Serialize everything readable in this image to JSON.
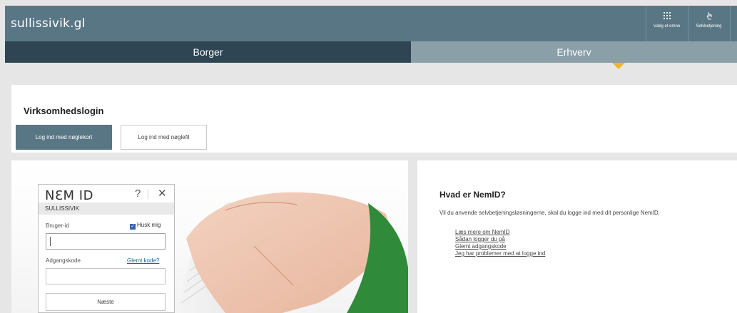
{
  "header": {
    "site_title": "sullissivik.gl",
    "utilities": [
      {
        "label": "Vælg et emne",
        "icon": "grid-icon"
      },
      {
        "label": "Selvbetjening",
        "icon": "touch-icon"
      }
    ]
  },
  "nav": {
    "tabs": [
      {
        "label": "Borger",
        "active": false
      },
      {
        "label": "Erhverv",
        "active": true
      }
    ]
  },
  "login": {
    "heading": "Virksomhedslogin",
    "buttons": [
      {
        "label": "Log ind med nøglekort",
        "selected": true
      },
      {
        "label": "Log ind med nøglefil",
        "selected": false
      }
    ]
  },
  "nemid": {
    "logo": "NƐM ID",
    "help": "?",
    "close": "✕",
    "organization": "SULLISSIVIK",
    "user_label": "Bruger-id",
    "remember_label": "Husk mig",
    "remember_checked": true,
    "user_value": "",
    "password_label": "Adgangskode",
    "forgot_label": "Glemt kode?",
    "password_value": "",
    "next_label": "Næste"
  },
  "info": {
    "title": "Hvad er NemID?",
    "text": "Vil du anvende selvbetjeningsløsningerne, skal du logge ind med dit personlige NemID.",
    "links": [
      "Læs mere om NemID",
      "Sådan logger du på",
      "Glemt adgangskode",
      "Jeg har problemer med at logge ind"
    ]
  },
  "colors": {
    "header_bg": "#597685",
    "tab_inactive": "#2f4553",
    "tab_active": "#8b9fa9",
    "accent": "#f1b52b",
    "link": "#1f5fa5"
  }
}
